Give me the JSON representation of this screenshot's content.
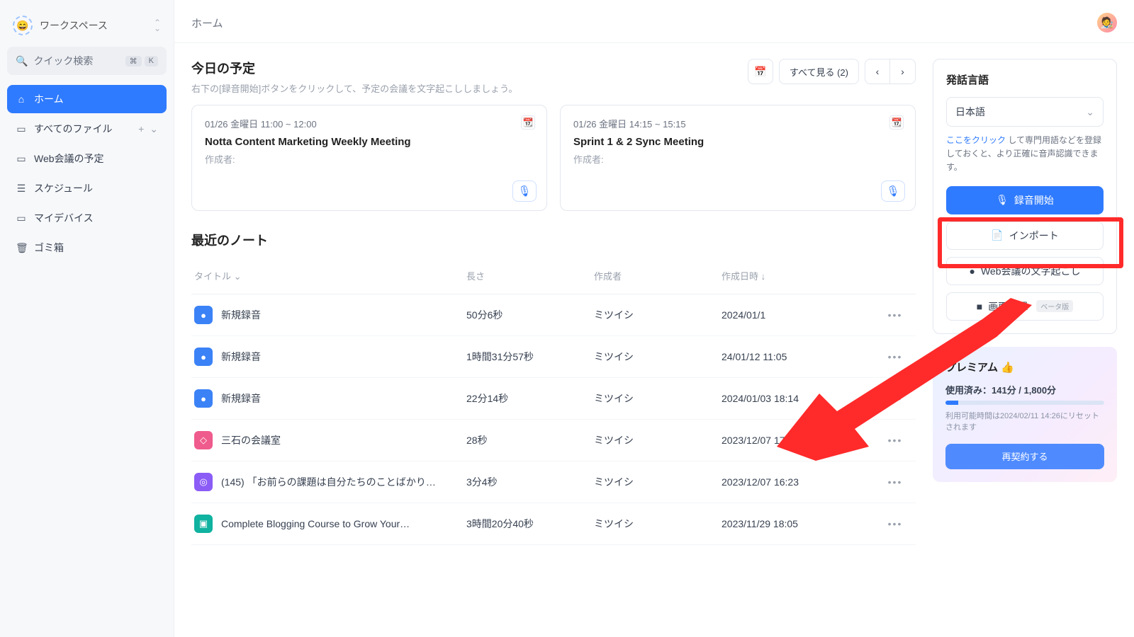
{
  "sidebar": {
    "workspace_label": "ワークスペース",
    "search_placeholder": "クイック検索",
    "kbd1": "⌘",
    "kbd2": "K",
    "items": [
      {
        "icon": "⌂",
        "label": "ホーム"
      },
      {
        "icon": "▭",
        "label": "すべてのファイル"
      },
      {
        "icon": "▭",
        "label": "Web会議の予定"
      },
      {
        "icon": "☰",
        "label": "スケジュール"
      },
      {
        "icon": "▭",
        "label": "マイデバイス"
      },
      {
        "icon": "🗑",
        "label": "ゴミ箱"
      }
    ]
  },
  "header": {
    "title": "ホーム"
  },
  "schedule": {
    "title": "今日の予定",
    "subtitle": "右下の[録音開始]ボタンをクリックして、予定の会議を文字起こししましょう。",
    "view_all": "すべて見る (2)",
    "cards": [
      {
        "date": "01/26 金曜日 11:00 ~ 12:00",
        "title": "Notta Content Marketing Weekly Meeting",
        "author": "作成者:"
      },
      {
        "date": "01/26 金曜日 14:15 ~ 15:15",
        "title": "Sprint 1 & 2 Sync Meeting",
        "author": "作成者:"
      }
    ]
  },
  "notes": {
    "title": "最近のノート",
    "cols": {
      "title": "タイトル",
      "length": "長さ",
      "author": "作成者",
      "created": "作成日時"
    },
    "rows": [
      {
        "badge": "b-blue",
        "icon": "●",
        "title": "新規録音",
        "length": "50分6秒",
        "author": "ミツイシ",
        "created": "2024/01/1"
      },
      {
        "badge": "b-blue",
        "icon": "●",
        "title": "新規録音",
        "length": "1時間31分57秒",
        "author": "ミツイシ",
        "created": "24/01/12 11:05"
      },
      {
        "badge": "b-blue",
        "icon": "●",
        "title": "新規録音",
        "length": "22分14秒",
        "author": "ミツイシ",
        "created": "2024/01/03 18:14"
      },
      {
        "badge": "b-pink",
        "icon": "◇",
        "title": "三石の会議室",
        "length": "28秒",
        "author": "ミツイシ",
        "created": "2023/12/07 17:59"
      },
      {
        "badge": "b-purple",
        "icon": "◎",
        "title": "(145) 「お前らの課題は自分たちのことばかり…",
        "length": "3分4秒",
        "author": "ミツイシ",
        "created": "2023/12/07 16:23"
      },
      {
        "badge": "b-teal",
        "icon": "▣",
        "title": "Complete Blogging Course to Grow Your…",
        "length": "3時間20分40秒",
        "author": "ミツイシ",
        "created": "2023/11/29 18:05"
      }
    ]
  },
  "right": {
    "lang_title": "発話言語",
    "lang_value": "日本語",
    "hint_link": "ここをクリック",
    "hint_rest": " して専門用語などを登録しておくと、より正確に音声認識できます。",
    "record": "録音開始",
    "import": "インポート",
    "transcribe": "Web会議の文字起こし",
    "screenrec": "画面収録",
    "beta": "ベータ版",
    "premium_title": "プレミアム 👍",
    "usage": "使用済み：141分 / 1,800分",
    "reset": "利用可能時間は2024/02/11 14:26にリセットされます",
    "renew": "再契約する"
  }
}
